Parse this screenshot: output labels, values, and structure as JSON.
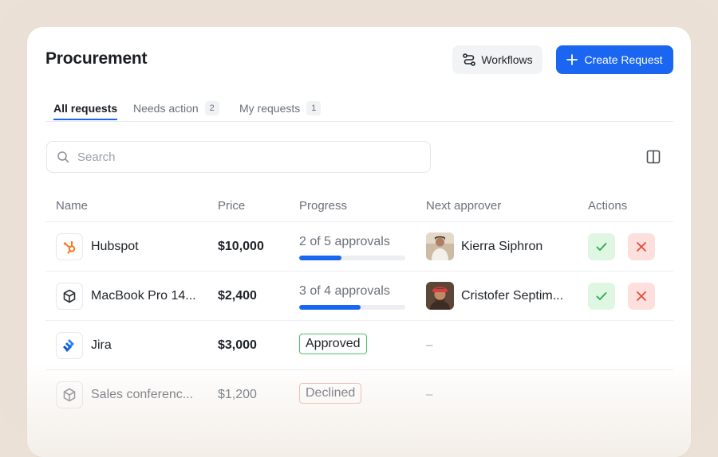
{
  "page": {
    "title": "Procurement"
  },
  "header": {
    "workflows_label": "Workflows",
    "create_label": "Create Request"
  },
  "tabs": [
    {
      "label": "All requests",
      "count": ""
    },
    {
      "label": "Needs action",
      "count": "2"
    },
    {
      "label": "My requests",
      "count": "1"
    }
  ],
  "search": {
    "placeholder": "Search",
    "value": ""
  },
  "table": {
    "columns": [
      "Name",
      "Price",
      "Progress",
      "Next approver",
      "Actions"
    ],
    "rows": [
      {
        "name": "Hubspot",
        "price": "$10,000",
        "progress_text": "2 of 5 approvals",
        "progress": 0.4,
        "approver": "Kierra Siphron",
        "logo": "hubspot-logo"
      },
      {
        "name": "MacBook Pro 14...",
        "price": "$2,400",
        "progress_text": "3 of 4 approvals",
        "progress": 0.58,
        "approver": "Cristofer Septim...",
        "logo": "box-icon"
      },
      {
        "name": "Jira",
        "price": "$3,000",
        "status": "Approved",
        "approver": "–",
        "logo": "jira-logo"
      },
      {
        "name": "Sales conferenc...",
        "price": "$1,200",
        "status": "Declined",
        "approver": "–",
        "logo": "box-icon"
      }
    ]
  },
  "colors": {
    "accent": "#1a66f1",
    "approve_bg": "#dff6e2",
    "decline_bg": "#fde0dd",
    "hubspot": "#f57722",
    "jira": "#2684ff"
  }
}
